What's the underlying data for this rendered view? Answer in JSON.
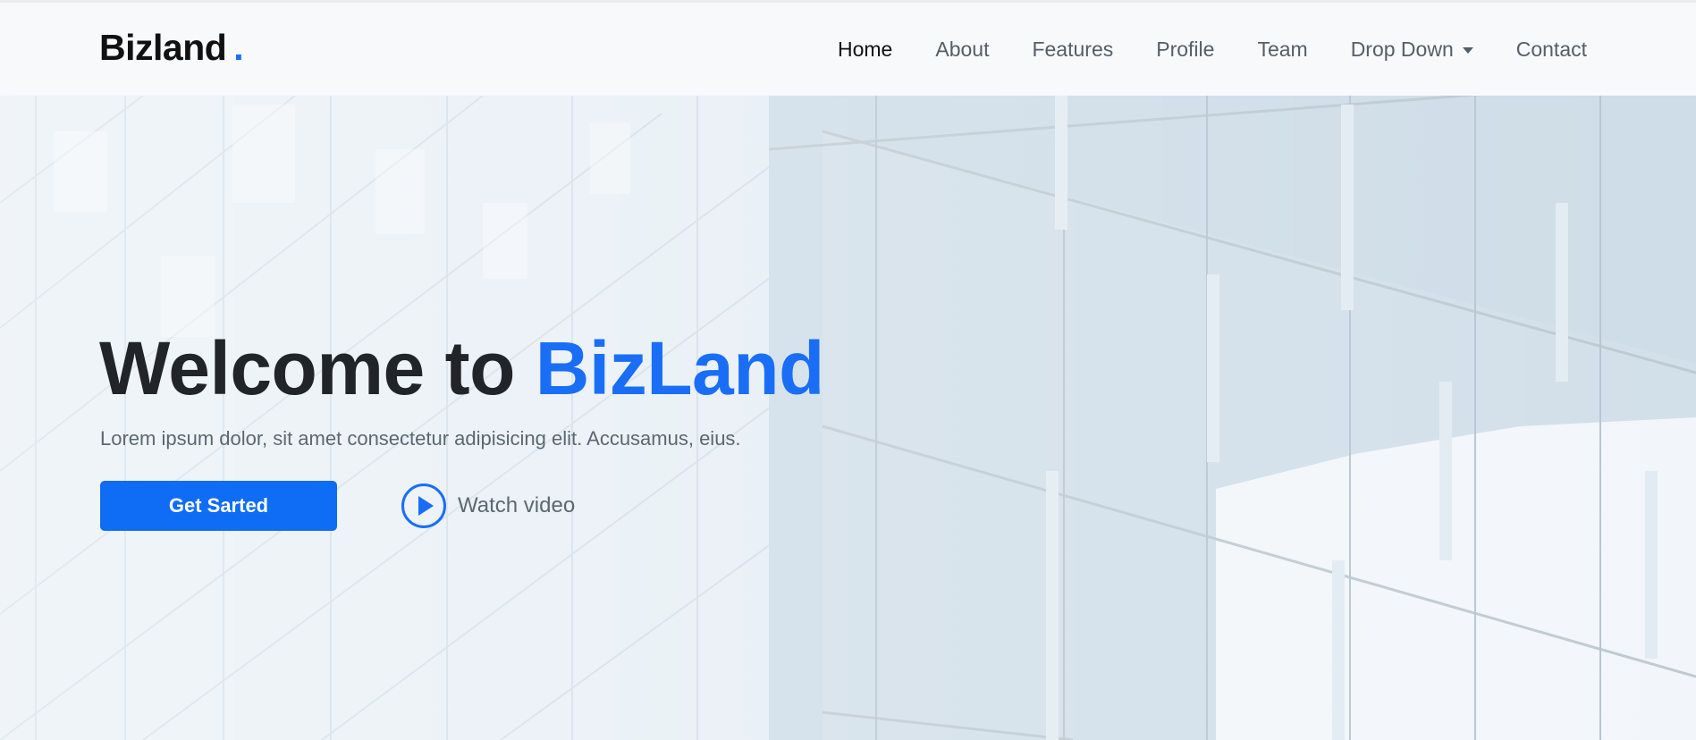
{
  "header": {
    "logo_text": "Bizland",
    "logo_dot": ".",
    "nav": [
      {
        "label": "Home",
        "active": true
      },
      {
        "label": "About"
      },
      {
        "label": "Features"
      },
      {
        "label": "Profile"
      },
      {
        "label": "Team"
      },
      {
        "label": "Drop Down",
        "has_dropdown": true
      },
      {
        "label": "Contact"
      }
    ]
  },
  "hero": {
    "title_prefix": "Welcome to ",
    "title_accent": "BizLand",
    "subtitle": "Lorem ipsum dolor, sit amet consectetur adipisicing elit. Accusamus, eius.",
    "primary_button": "Get Sarted",
    "video_link": "Watch video",
    "play_icon": "play-circle-icon",
    "dropdown_icon": "caret-down-icon"
  },
  "colors": {
    "accent": "#1a6ef5",
    "button": "#0f6cf5",
    "header_bg": "#f7f9fb",
    "title_text": "#212529",
    "muted_text": "#5c6870"
  }
}
